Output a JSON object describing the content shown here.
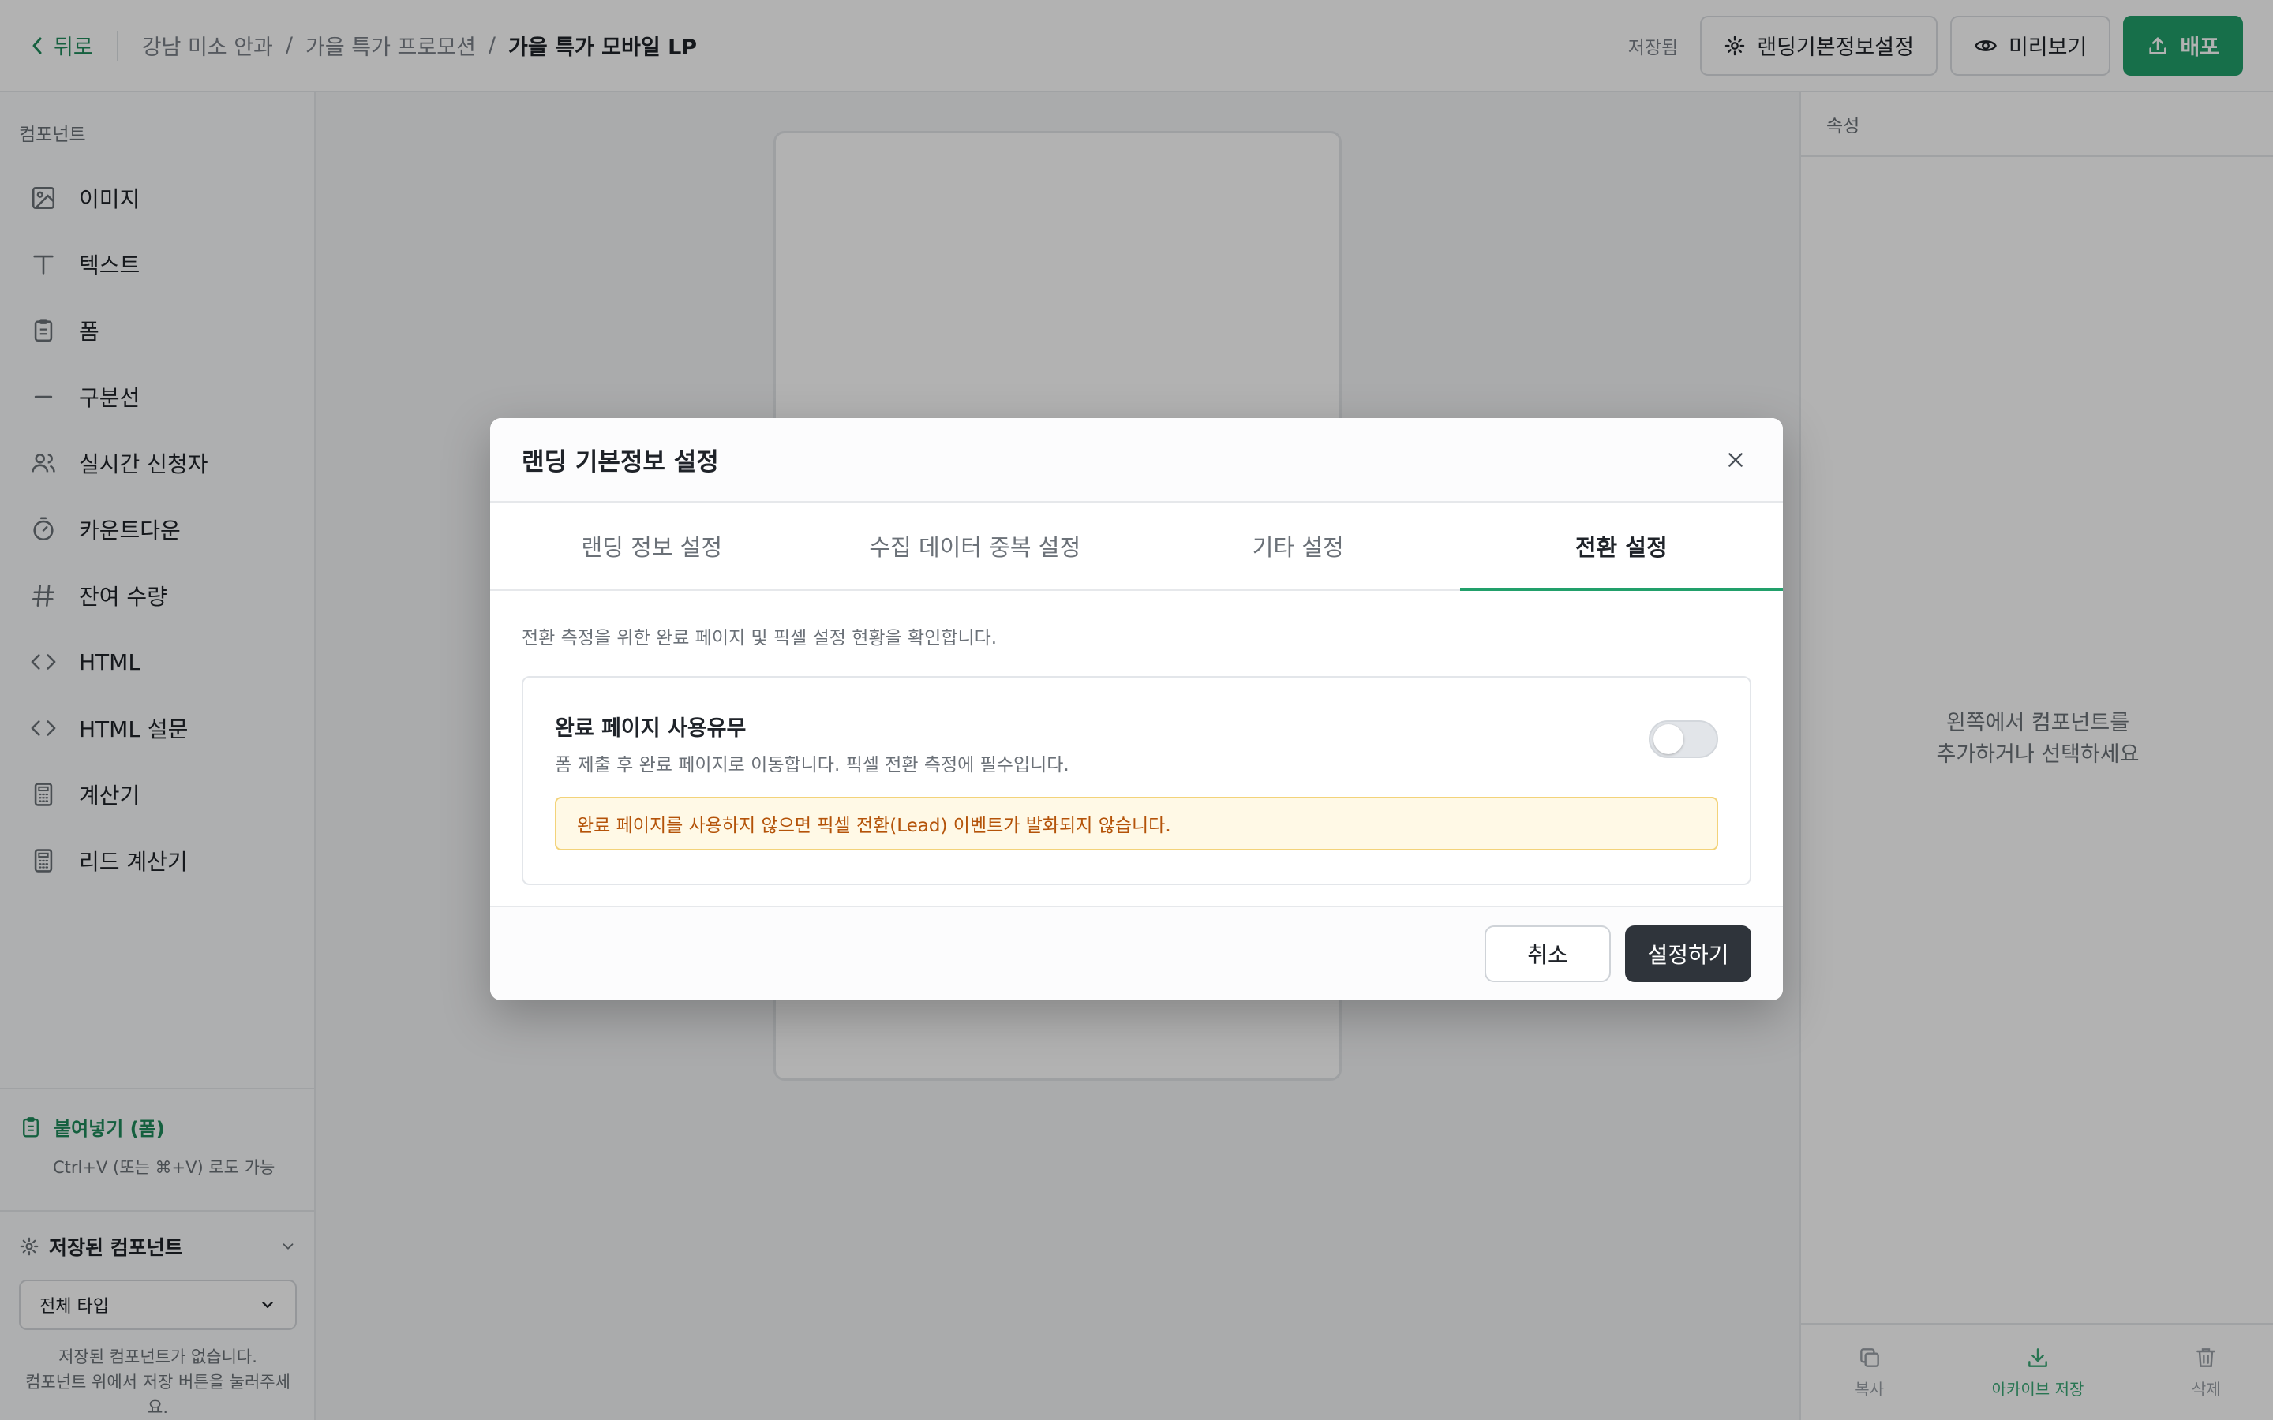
{
  "header": {
    "back_label": "뒤로",
    "breadcrumbs": [
      "강남 미소 안과",
      "가을 특가 프로모션",
      "가을 특가 모바일 LP"
    ],
    "separator": "/",
    "saved_status": "저장됨",
    "settings_button": "랜딩기본정보설정",
    "preview_button": "미리보기",
    "deploy_button": "배포"
  },
  "sidebar": {
    "title": "컴포넌트",
    "items": [
      {
        "label": "이미지",
        "icon": "image-icon"
      },
      {
        "label": "텍스트",
        "icon": "text-icon"
      },
      {
        "label": "폼",
        "icon": "clipboard-icon"
      },
      {
        "label": "구분선",
        "icon": "minus-icon"
      },
      {
        "label": "실시간 신청자",
        "icon": "users-icon"
      },
      {
        "label": "카운트다운",
        "icon": "timer-icon"
      },
      {
        "label": "잔여 수량",
        "icon": "hash-icon"
      },
      {
        "label": "HTML",
        "icon": "code-icon"
      },
      {
        "label": "HTML 설문",
        "icon": "code-icon"
      },
      {
        "label": "계산기",
        "icon": "calculator-icon"
      },
      {
        "label": "리드 계산기",
        "icon": "calculator-icon"
      }
    ],
    "paste": {
      "title": "붙여넣기 (폼)",
      "hint": "Ctrl+V (또는 ⌘+V) 로도 가능"
    },
    "saved_components": {
      "title": "저장된 컴포넌트",
      "filter_value": "전체 타입",
      "empty_line1": "저장된 컴포넌트가 없습니다.",
      "empty_line2": "컴포넌트 위에서 저장 버튼을 눌러주세요."
    }
  },
  "right_panel": {
    "title": "속성",
    "empty_line1": "왼쪽에서 컴포넌트를",
    "empty_line2": "추가하거나 선택하세요",
    "actions": {
      "copy": "복사",
      "archive": "아카이브 저장",
      "delete": "삭제"
    }
  },
  "modal": {
    "title": "랜딩 기본정보 설정",
    "tabs": [
      "랜딩 정보 설정",
      "수집 데이터 중복 설정",
      "기타 설정",
      "전환 설정"
    ],
    "active_tab": 3,
    "description": "전환 측정을 위한 완료 페이지 및 픽셀 설정 현황을 확인합니다.",
    "completion_page": {
      "title": "완료 페이지 사용유무",
      "subtitle": "폼 제출 후 완료 페이지로 이동합니다. 픽셀 전환 측정에 필수입니다.",
      "enabled": false,
      "warning": "완료 페이지를 사용하지 않으면 픽셀 전환(Lead) 이벤트가 발화되지 않습니다."
    },
    "cancel_button": "취소",
    "confirm_button": "설정하기"
  },
  "colors": {
    "accent": "#22a06b",
    "dark_button": "#2f343b",
    "warning_text": "#b45309",
    "warning_bg": "#fff9e6"
  }
}
